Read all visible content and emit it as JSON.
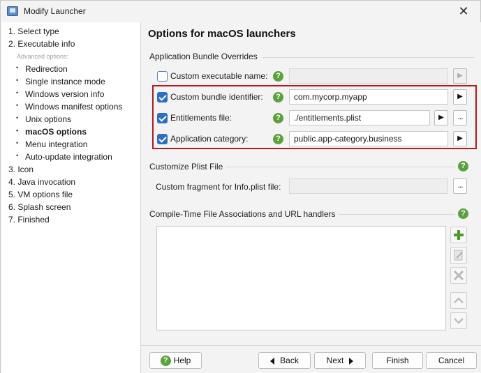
{
  "window": {
    "title": "Modify Launcher",
    "close_glyph": "✕"
  },
  "sidebar": {
    "steps": [
      "1. Select type",
      "2. Executable info",
      "3. Icon",
      "4. Java invocation",
      "5. VM options file",
      "6. Splash screen",
      "7. Finished"
    ],
    "advanced_label": "Advanced options:",
    "substeps": [
      "Redirection",
      "Single instance mode",
      "Windows version info",
      "Windows manifest options",
      "Unix options",
      "macOS options",
      "Menu integration",
      "Auto-update integration"
    ],
    "active_substep": "macOS options"
  },
  "main": {
    "title": "Options for macOS launchers",
    "bundle": {
      "section_title": "Application Bundle Overrides",
      "exec_name": {
        "label": "Custom executable name:",
        "checked": false,
        "value": ""
      },
      "bundle_id": {
        "label": "Custom bundle identifier:",
        "checked": true,
        "value": "com.mycorp.myapp"
      },
      "entitlements": {
        "label": "Entitlements file:",
        "checked": true,
        "value": "./entitlements.plist"
      },
      "category": {
        "label": "Application category:",
        "checked": true,
        "value": "public.app-category.business"
      }
    },
    "plist": {
      "section_title": "Customize Plist File",
      "fragment_label": "Custom fragment for Info.plist file:",
      "fragment_value": ""
    },
    "associations": {
      "section_title": "Compile-Time File Associations and URL handlers",
      "items": []
    },
    "help_glyph": "?",
    "ellipsis": "...",
    "arrow_glyph": "▶"
  },
  "footer": {
    "help": "Help",
    "back": "Back",
    "next": "Next",
    "finish": "Finish",
    "cancel": "Cancel"
  },
  "colors": {
    "accent": "#2c6fc7",
    "help_green": "#5aa23a",
    "highlight_red": "#b01c1c"
  }
}
